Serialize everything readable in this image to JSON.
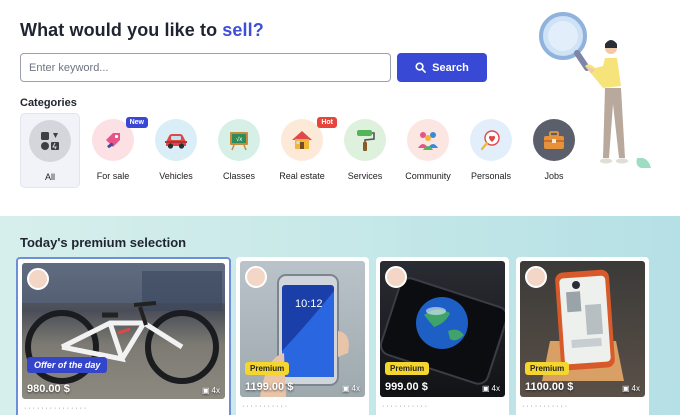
{
  "header": {
    "title_prefix": "What would you like to ",
    "title_accent": "sell?"
  },
  "search": {
    "placeholder": "Enter keyword...",
    "button_label": "Search"
  },
  "categories": {
    "heading": "Categories",
    "items": [
      {
        "label": "All",
        "icon": "grid-icon",
        "badge": ""
      },
      {
        "label": "For sale",
        "icon": "tag-icon",
        "badge": "New"
      },
      {
        "label": "Vehicles",
        "icon": "car-icon",
        "badge": ""
      },
      {
        "label": "Classes",
        "icon": "chalkboard-icon",
        "badge": ""
      },
      {
        "label": "Real estate",
        "icon": "house-icon",
        "badge": "Hot"
      },
      {
        "label": "Services",
        "icon": "paint-roller-icon",
        "badge": ""
      },
      {
        "label": "Community",
        "icon": "people-icon",
        "badge": ""
      },
      {
        "label": "Personals",
        "icon": "heart-pin-icon",
        "badge": ""
      },
      {
        "label": "Jobs",
        "icon": "briefcase-icon",
        "badge": ""
      }
    ]
  },
  "premium": {
    "title": "Today's premium selection",
    "listings": [
      {
        "price": "980.00 $",
        "tag": "Offer of the day",
        "photos": "4x",
        "image": "bicycle-photo"
      },
      {
        "price": "1199.00 $",
        "tag": "Premium",
        "photos": "4x",
        "image": "phone-photo"
      },
      {
        "price": "999.00 $",
        "tag": "Premium",
        "photos": "4x",
        "image": "phone-photo"
      },
      {
        "price": "1100.00 $",
        "tag": "Premium",
        "photos": "4x",
        "image": "phone-photo"
      }
    ]
  },
  "colors": {
    "accent": "#3f4fd6",
    "button": "#3849d6",
    "premium_badge": "#f5d62e",
    "hot_badge": "#e6453b"
  }
}
